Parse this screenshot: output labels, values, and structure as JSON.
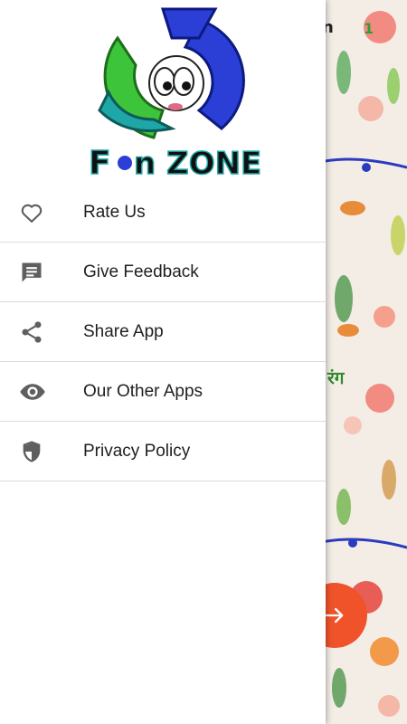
{
  "background": {
    "top_number": "1",
    "hindi_text": "रंग",
    "fab_icon": "arrow-right-icon"
  },
  "drawer": {
    "logo": {
      "text_part1": "F",
      "text_part2": "n ZONE",
      "brand_colors": {
        "blue": "#2b3fd6",
        "green": "#3ec43a",
        "teal": "#1fa6a6",
        "dark": "#111111"
      }
    },
    "menu_items": [
      {
        "label": "Rate Us",
        "icon": "heart-outline-icon"
      },
      {
        "label": "Give Feedback",
        "icon": "feedback-icon"
      },
      {
        "label": "Share App",
        "icon": "share-icon"
      },
      {
        "label": "Our Other Apps",
        "icon": "eye-icon"
      },
      {
        "label": "Privacy Policy",
        "icon": "shield-icon"
      }
    ]
  },
  "colors": {
    "icon_gray": "#5f5f5f",
    "divider": "#dcdcdc",
    "fab": "#f0532a"
  }
}
